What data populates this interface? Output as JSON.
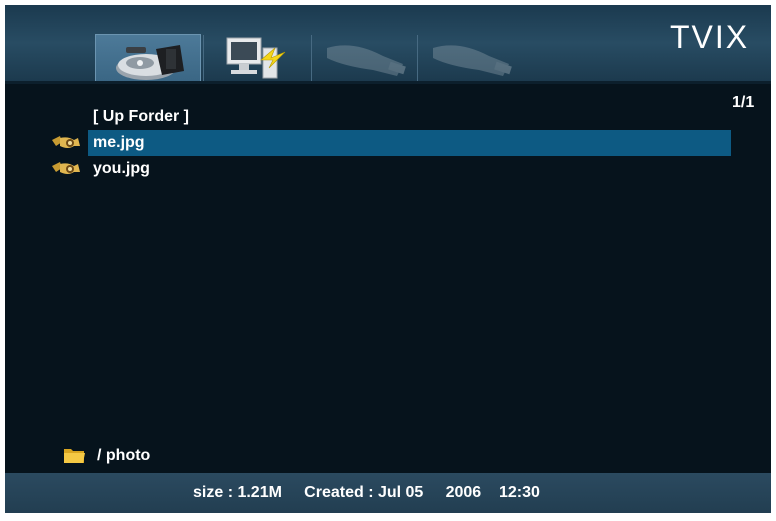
{
  "header": {
    "brand": "TVIX",
    "tabs": [
      {
        "name": "hdd",
        "icon": "hard-drive-icon",
        "active": true
      },
      {
        "name": "network",
        "icon": "network-pc-icon",
        "active": false
      },
      {
        "name": "usb-1",
        "icon": "usb-device-icon",
        "active": false
      },
      {
        "name": "usb-2",
        "icon": "usb-device-icon",
        "active": false
      }
    ]
  },
  "page_indicator": "1/1",
  "file_list": {
    "items": [
      {
        "label": "[ Up Forder ]",
        "icon": "",
        "selected": false
      },
      {
        "label": "me.jpg",
        "icon": "photo-file-icon",
        "selected": true
      },
      {
        "label": "you.jpg",
        "icon": "photo-file-icon",
        "selected": false
      }
    ]
  },
  "path": {
    "icon": "folder-icon",
    "text": "/ photo"
  },
  "status": {
    "size": "size : 1.21M",
    "created": "Created : Jul 05",
    "year": "2006",
    "time": "12:30"
  },
  "colors": {
    "background": "#06131c",
    "selection": "#0d5a83",
    "header": "#284c63",
    "status_bar": "#2b4a60"
  }
}
